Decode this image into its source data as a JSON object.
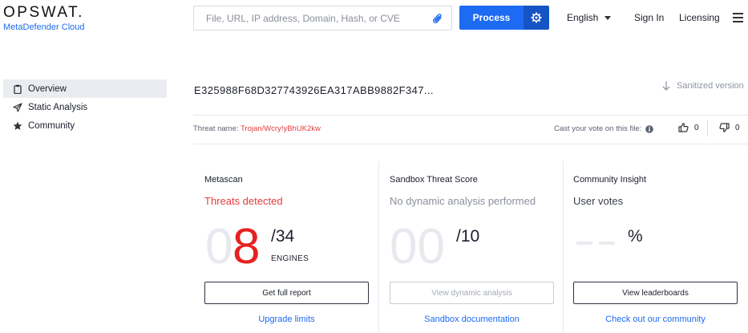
{
  "header": {
    "logo_main": "OPSWAT.",
    "logo_sub": "MetaDefender Cloud",
    "search_placeholder": "File, URL, IP address, Domain, Hash, or CVE",
    "process_label": "Process",
    "language": "English",
    "sign_in": "Sign In",
    "licensing": "Licensing"
  },
  "sidebar": {
    "items": [
      {
        "label": "Overview",
        "icon": "clipboard-icon",
        "active": true
      },
      {
        "label": "Static Analysis",
        "icon": "send-icon",
        "active": false
      },
      {
        "label": "Community",
        "icon": "star-icon",
        "active": false
      }
    ]
  },
  "file": {
    "hash": "E325988F68D327743926EA317ABB9882F347...",
    "sanitized_label": "Sanitized version",
    "threat_label": "Threat name:",
    "threat_name": "Trojan/Wcry!yBhUK2kw",
    "vote_label": "Cast your vote on this file:",
    "upvotes": "0",
    "downvotes": "0"
  },
  "cards": {
    "metascan": {
      "title": "Metascan",
      "status": "Threats detected",
      "digit_dim": "0",
      "digit_value": "8",
      "total": "/34",
      "engines_label": "ENGINES",
      "button": "Get full report",
      "link": "Upgrade limits"
    },
    "sandbox": {
      "title": "Sandbox Threat Score",
      "status": "No dynamic analysis performed",
      "score": "00",
      "total": "/10",
      "button": "View dynamic analysis",
      "link": "Sandbox documentation"
    },
    "community": {
      "title": "Community Insight",
      "status": "User votes",
      "percent": "%",
      "button": "View leaderboards",
      "link": "Check out our community"
    }
  },
  "colors": {
    "accent": "#1d6bf3",
    "accent_dark": "#1554c4",
    "danger": "#e62121",
    "threat_text": "#e43c3c",
    "muted": "#8f96a3"
  }
}
